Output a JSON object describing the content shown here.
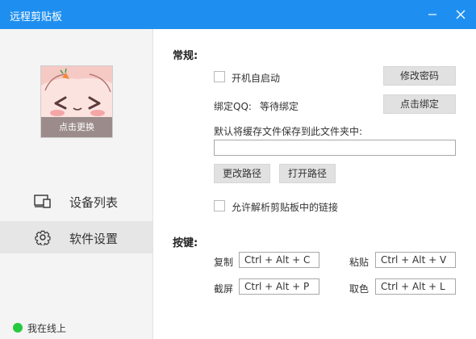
{
  "window": {
    "title": "远程剪贴板",
    "minimize_glyph": "—",
    "close_glyph": "✕",
    "titlebar_color": "#1e8ff0"
  },
  "sidebar": {
    "avatar_caption": "点击更换",
    "nav": [
      {
        "label": "设备列表",
        "icon": "devices-icon",
        "active": false
      },
      {
        "label": "软件设置",
        "icon": "gear-icon",
        "active": true
      }
    ],
    "status": {
      "text": "我在线上",
      "color": "#27c93f"
    }
  },
  "general": {
    "title": "常规:",
    "autostart_label": "开机自启动",
    "autostart_checked": false,
    "change_password_label": "修改密码",
    "bind_qq_label": "绑定QQ:",
    "bind_qq_status": "等待绑定",
    "bind_button_label": "点击绑定",
    "cache_folder_label": "默认将缓存文件保存到此文件夹中:",
    "cache_folder_value": "",
    "change_path_label": "更改路径",
    "open_path_label": "打开路径",
    "parse_links_label": "允许解析剪贴板中的链接",
    "parse_links_checked": false
  },
  "hotkeys": {
    "title": "按键:",
    "items": [
      {
        "label": "复制",
        "value": "Ctrl + Alt + C"
      },
      {
        "label": "粘贴",
        "value": "Ctrl + Alt + V"
      },
      {
        "label": "截屏",
        "value": "Ctrl + Alt + P"
      },
      {
        "label": "取色",
        "value": "Ctrl + Alt + L"
      }
    ]
  }
}
